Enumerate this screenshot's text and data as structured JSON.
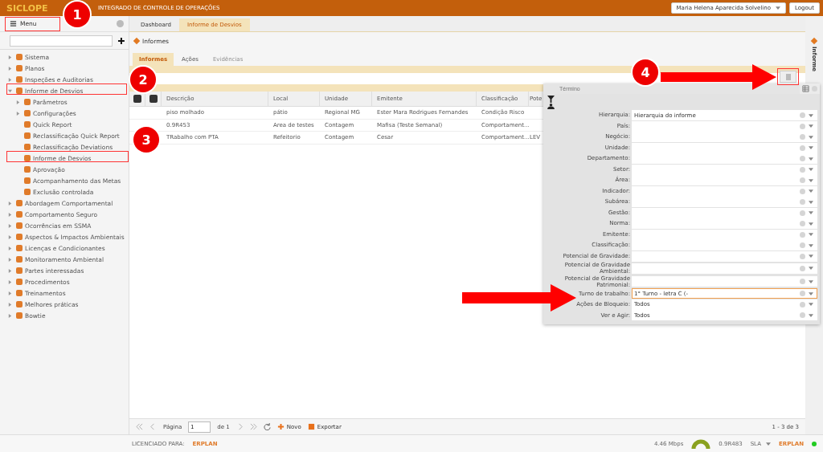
{
  "topbar": {
    "logo": "SICLOPE",
    "title": "INTEGRADO DE CONTROLE DE OPERAÇÕES",
    "user": "Maria Helena Aparecida Solvelino",
    "logout": "Logout"
  },
  "sidebar": {
    "header": "Menu",
    "items": [
      {
        "label": "Sistema",
        "expanded": false
      },
      {
        "label": "Planos",
        "expanded": false
      },
      {
        "label": "Inspeções e Auditorias",
        "expanded": false
      },
      {
        "label": "Informe de Desvios",
        "expanded": true,
        "children": [
          {
            "label": "Parâmetros",
            "expanded": false
          },
          {
            "label": "Configurações",
            "expanded": false
          },
          {
            "label": "Quick Report"
          },
          {
            "label": "Reclassificação Quick Report"
          },
          {
            "label": "Reclassificação Deviations"
          },
          {
            "label": "Informe de Desvios"
          },
          {
            "label": "Aprovação"
          },
          {
            "label": "Acompanhamento das Metas"
          },
          {
            "label": "Exclusão controlada"
          }
        ]
      },
      {
        "label": "Abordagem Comportamental",
        "expanded": false
      },
      {
        "label": "Comportamento Seguro",
        "expanded": false
      },
      {
        "label": "Ocorrências em SSMA",
        "expanded": false
      },
      {
        "label": "Aspectos & Impactos Ambientais",
        "expanded": false
      },
      {
        "label": "Licenças e Condicionantes",
        "expanded": false
      },
      {
        "label": "Monitoramento Ambiental",
        "expanded": false
      },
      {
        "label": "Partes interessadas",
        "expanded": false
      },
      {
        "label": "Procedimentos",
        "expanded": false
      },
      {
        "label": "Treinamentos",
        "expanded": false
      },
      {
        "label": "Melhores práticas",
        "expanded": false
      },
      {
        "label": "Bowtie",
        "expanded": false
      }
    ]
  },
  "tabs": [
    {
      "label": "Dashboard",
      "selected": false
    },
    {
      "label": "Informe de Desvios",
      "selected": true
    }
  ],
  "page_title": "Informes",
  "subtabs": [
    {
      "label": "Informes",
      "selected": true,
      "disabled": false
    },
    {
      "label": "Ações",
      "selected": false,
      "disabled": false
    },
    {
      "label": "Evidências",
      "selected": false,
      "disabled": true
    }
  ],
  "table": {
    "columns": [
      "Descrição",
      "Local",
      "Unidade",
      "Emitente",
      "Classificação",
      "Pote"
    ],
    "rows": [
      [
        "piso molhado",
        "pátio",
        "Regional MG",
        "Ester Mara Rodrigues Fernandes",
        "Condição Risco",
        null
      ],
      [
        "0.9R453",
        "Area de testes",
        "Contagem",
        "Mafisa (Teste Semanal)",
        "Comportament...",
        null
      ],
      [
        "TRabalho com PTA",
        "Refeitorio",
        "Contagem",
        "Cesar",
        "Comportament...",
        "LEV"
      ]
    ]
  },
  "filter_panel": {
    "term": {
      "placeholder": "Término"
    },
    "fields": [
      {
        "label": "Hierarquia:",
        "value": "Hierarquia do informe",
        "focused": false
      },
      {
        "label": "País:",
        "focused": false
      },
      {
        "label": "Negócio:",
        "focused": false
      },
      {
        "label": "Unidade:",
        "focused": false
      },
      {
        "label": "Departamento:",
        "focused": false
      },
      {
        "label": "Setor:",
        "focused": false
      },
      {
        "label": "Área:",
        "focused": false
      },
      {
        "label": "Indicador:",
        "focused": false
      },
      {
        "label": "Subárea:",
        "focused": false
      },
      {
        "label": "Gestão:",
        "focused": false
      },
      {
        "label": "Norma:",
        "focused": false
      },
      {
        "label": "Emitente:",
        "focused": false
      },
      {
        "label": "Classificação:",
        "focused": false
      },
      {
        "label": "Potencial de Gravidade:",
        "focused": false
      },
      {
        "label": "Potencial de Gravidade Ambiental:",
        "focused": false
      },
      {
        "label": "Potencial de Gravidade Patrimonial:",
        "focused": false
      },
      {
        "label": "Turno de trabalho:",
        "value": "1° Turno - letra C (-",
        "focused": true
      },
      {
        "label": "Ações de Bloqueio:",
        "value": "Todos",
        "focused": false
      },
      {
        "label": "Ver e Agir:",
        "value": "Todos",
        "focused": false
      }
    ]
  },
  "right_strip": "Informe",
  "pager": {
    "page_label": "Página",
    "page": "1",
    "of": "de 1",
    "new": "Novo",
    "export": "Exportar",
    "count": "1 - 3 de 3"
  },
  "status_bar": {
    "licensed": "LICENCIADO PARA:",
    "brand": "ERPLAN",
    "speed": "4.46 Mbps",
    "version": "0.9R483",
    "sla": "SLA",
    "brand_right": "ERPLAN"
  },
  "callouts": [
    "1",
    "2",
    "3",
    "4"
  ]
}
